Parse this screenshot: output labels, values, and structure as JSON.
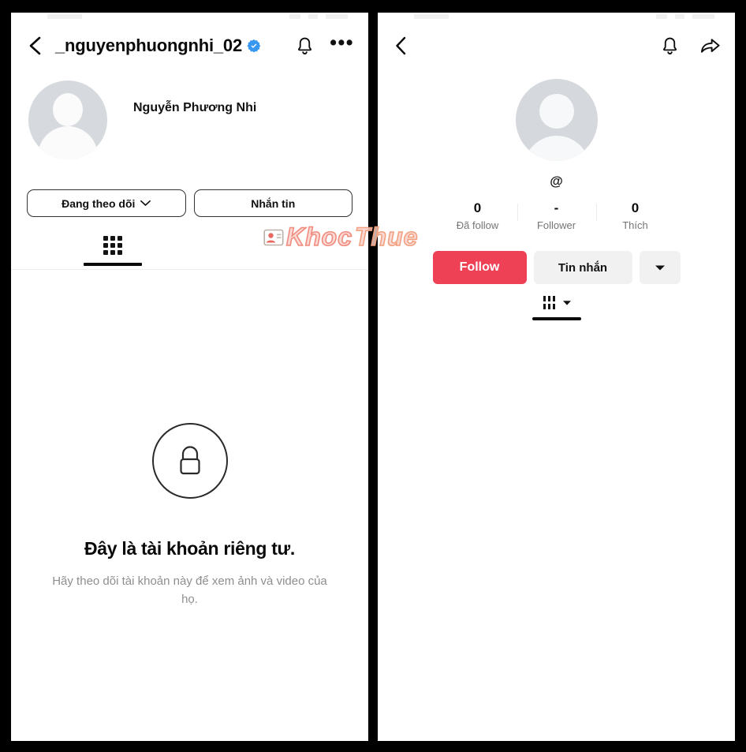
{
  "theme": {
    "frame_color": "#000000",
    "panel_bg": "#ffffff",
    "verified_blue": "#3897f0",
    "tiktok_red": "#ee4156",
    "muted_text": "#8e8e8e",
    "avatar_gray": "#d6d9dd"
  },
  "left_panel": {
    "app": "instagram-profile",
    "header": {
      "back_icon": "chevron-left-icon",
      "username": "_nguyenphuongnhi_02",
      "verified_icon": "verified-badge-icon",
      "bell_icon": "bell-icon",
      "more_icon": "ellipsis-icon",
      "more_label": "•••"
    },
    "profile": {
      "avatar_icon": "default-avatar-icon",
      "full_name": "Nguyễn Phương Nhi"
    },
    "actions": {
      "following_label": "Đang theo dõi",
      "following_caret_icon": "chevron-down-icon",
      "message_label": "Nhắn tin"
    },
    "tabs": [
      {
        "name": "grid",
        "icon": "grid-icon",
        "active": true
      }
    ],
    "private_notice": {
      "lock_icon": "lock-icon",
      "title": "Đây là tài khoản riêng tư.",
      "subtitle": "Hãy theo dõi tài khoản này để xem ảnh và video của họ."
    }
  },
  "right_panel": {
    "app": "tiktok-profile",
    "header": {
      "back_icon": "chevron-left-icon",
      "bell_icon": "bell-icon",
      "share_icon": "share-arrow-icon"
    },
    "profile": {
      "avatar_icon": "default-avatar-icon",
      "handle": "@"
    },
    "stats": [
      {
        "value": "0",
        "label": "Đã follow"
      },
      {
        "value": "-",
        "label": "Follower"
      },
      {
        "value": "0",
        "label": "Thích"
      }
    ],
    "actions": {
      "follow_label": "Follow",
      "message_label": "Tin nhắn",
      "more_icon": "caret-down-icon"
    },
    "tabs": [
      {
        "name": "videos",
        "icon": "tiktok-grid-icon",
        "caret_icon": "caret-down-icon",
        "active": true
      }
    ]
  },
  "watermark": {
    "icon": "contact-card-icon",
    "text_1": "Khoc",
    "text_2": "Thue"
  }
}
